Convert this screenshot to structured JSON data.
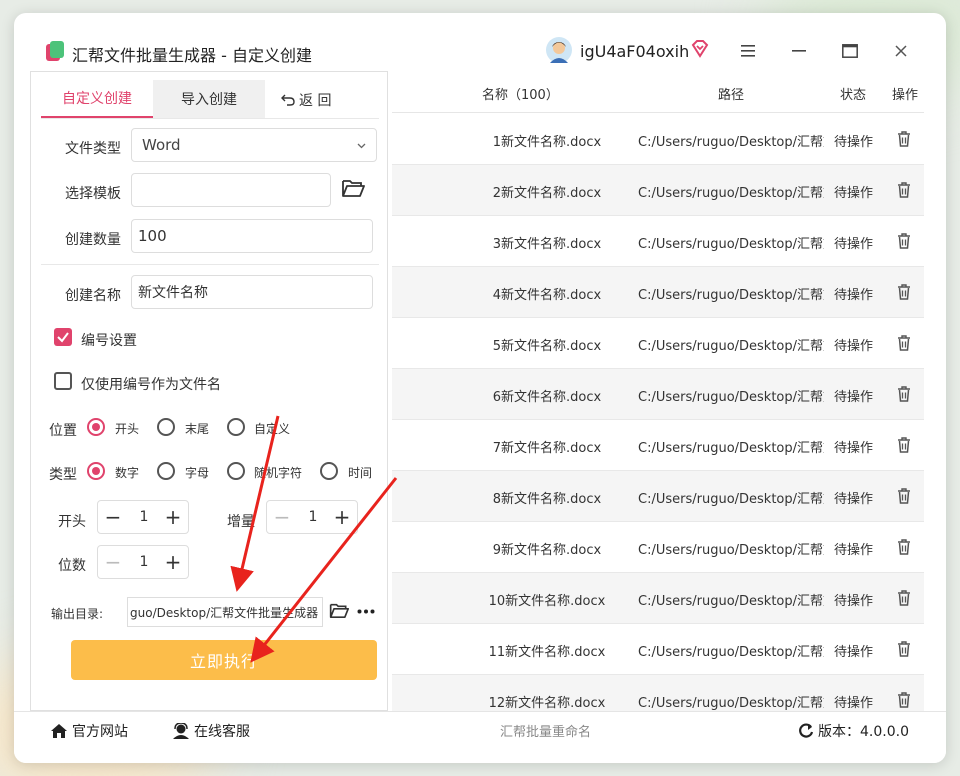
{
  "window": {
    "title": "汇帮文件批量生成器 - 自定义创建",
    "username": "igU4aF04oxih"
  },
  "tabs": {
    "custom": "自定义创建",
    "import": "导入创建",
    "back": "返 回"
  },
  "form": {
    "file_type_label": "文件类型",
    "file_type_value": "Word",
    "template_label": "选择模板",
    "template_value": "",
    "count_label": "创建数量",
    "count_value": "100",
    "name_label": "创建名称",
    "name_value": "新文件名称"
  },
  "numbering": {
    "enable_label": "编号设置",
    "enable_checked": true,
    "only_number_label": "仅使用编号作为文件名",
    "only_number_checked": false,
    "position_label": "位置",
    "position_options": [
      "开头",
      "末尾",
      "自定义"
    ],
    "position_selected": "开头",
    "type_label": "类型",
    "type_options": [
      "数字",
      "字母",
      "随机字符",
      "时间"
    ],
    "type_selected": "数字",
    "start_label": "开头",
    "start_value": "1",
    "increment_label": "增量",
    "increment_value": "1",
    "digits_label": "位数",
    "digits_value": "1"
  },
  "output": {
    "label": "输出目录:",
    "path": "guo/Desktop/汇帮文件批量生成器",
    "run_label": "立即执行"
  },
  "table": {
    "headers": {
      "name": "名称（100）",
      "path": "路径",
      "status": "状态",
      "action": "操作"
    },
    "rows": [
      {
        "name": "1新文件名称.docx",
        "path": "C:/Users/ruguo/Desktop/汇帮文",
        "status": "待操作"
      },
      {
        "name": "2新文件名称.docx",
        "path": "C:/Users/ruguo/Desktop/汇帮文",
        "status": "待操作"
      },
      {
        "name": "3新文件名称.docx",
        "path": "C:/Users/ruguo/Desktop/汇帮文",
        "status": "待操作"
      },
      {
        "name": "4新文件名称.docx",
        "path": "C:/Users/ruguo/Desktop/汇帮文",
        "status": "待操作"
      },
      {
        "name": "5新文件名称.docx",
        "path": "C:/Users/ruguo/Desktop/汇帮文",
        "status": "待操作"
      },
      {
        "name": "6新文件名称.docx",
        "path": "C:/Users/ruguo/Desktop/汇帮文",
        "status": "待操作"
      },
      {
        "name": "7新文件名称.docx",
        "path": "C:/Users/ruguo/Desktop/汇帮文",
        "status": "待操作"
      },
      {
        "name": "8新文件名称.docx",
        "path": "C:/Users/ruguo/Desktop/汇帮文",
        "status": "待操作"
      },
      {
        "name": "9新文件名称.docx",
        "path": "C:/Users/ruguo/Desktop/汇帮文",
        "status": "待操作"
      },
      {
        "name": "10新文件名称.docx",
        "path": "C:/Users/ruguo/Desktop/汇帮文",
        "status": "待操作"
      },
      {
        "name": "11新文件名称.docx",
        "path": "C:/Users/ruguo/Desktop/汇帮文",
        "status": "待操作"
      },
      {
        "name": "12新文件名称.docx",
        "path": "C:/Users/ruguo/Desktop/汇帮文",
        "status": "待操作"
      }
    ]
  },
  "footer": {
    "website": "官方网站",
    "support": "在线客服",
    "center": "汇帮批量重命名",
    "version": "版本：4.0.0.0"
  },
  "colors": {
    "accent": "#e0436c",
    "run_button": "#fcbd4a",
    "annotation_arrow": "#e8231d"
  }
}
